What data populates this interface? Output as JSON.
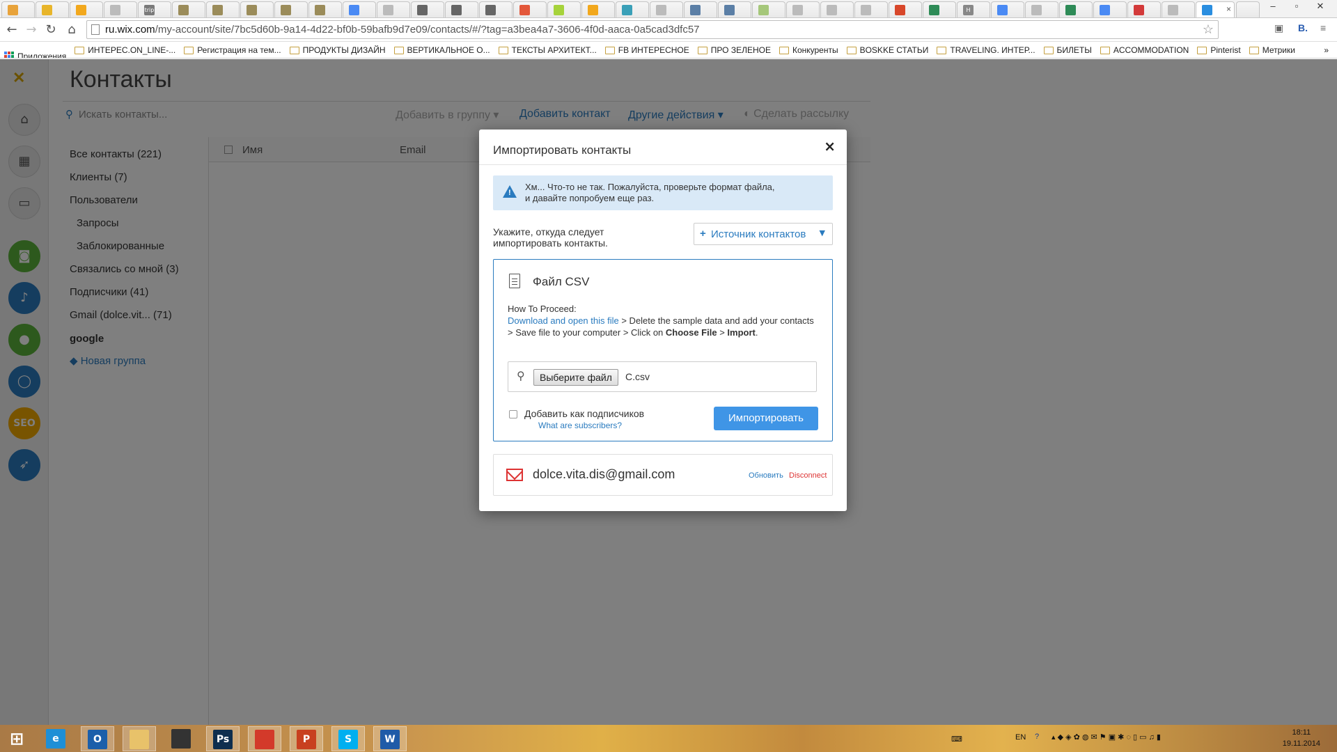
{
  "browser": {
    "tabs": [
      {
        "icon": "blogger-icon",
        "color": "#e8a33b"
      },
      {
        "icon": "wix-icon",
        "color": "#e8b52a"
      },
      {
        "icon": "v-icon",
        "color": "#f2a81d"
      },
      {
        "icon": "page-icon",
        "color": "#bbbbbb"
      },
      {
        "icon": "trip-icon",
        "color": "#7a7a7a",
        "text": "trip"
      },
      {
        "icon": "tv-icon",
        "color": "#9b8c5a"
      },
      {
        "icon": "tv-icon",
        "color": "#9b8c5a"
      },
      {
        "icon": "tv-icon",
        "color": "#9b8c5a"
      },
      {
        "icon": "tv-icon",
        "color": "#9b8c5a"
      },
      {
        "icon": "tv-icon",
        "color": "#9b8c5a"
      },
      {
        "icon": "google-icon",
        "color": "#4a8af4"
      },
      {
        "icon": "page-icon",
        "color": "#bbbbbb"
      },
      {
        "icon": "c-icon",
        "color": "#666666"
      },
      {
        "icon": "c-icon",
        "color": "#666666"
      },
      {
        "icon": "c-icon",
        "color": "#666666"
      },
      {
        "icon": "app-icon",
        "color": "#e3573a"
      },
      {
        "icon": "check-icon",
        "color": "#a6d33b"
      },
      {
        "icon": "v-icon",
        "color": "#f2a81d"
      },
      {
        "icon": "circle-icon",
        "color": "#3aa0b8"
      },
      {
        "icon": "page-icon",
        "color": "#bbbbbb"
      },
      {
        "icon": "vk-icon",
        "color": "#5b7fa6"
      },
      {
        "icon": "vk-icon",
        "color": "#5b7fa6"
      },
      {
        "icon": "image-icon",
        "color": "#a5c77a"
      },
      {
        "icon": "page-icon",
        "color": "#bbbbbb"
      },
      {
        "icon": "page-icon",
        "color": "#bbbbbb"
      },
      {
        "icon": "page-icon",
        "color": "#bbbbbb"
      },
      {
        "icon": "chrome-icon",
        "color": "#d8472a"
      },
      {
        "icon": "sheet-icon",
        "color": "#2e8b57"
      },
      {
        "icon": "h-icon",
        "color": "#888888",
        "text": "H"
      },
      {
        "icon": "google-icon",
        "color": "#4a8af4"
      },
      {
        "icon": "page-icon",
        "color": "#bbbbbb"
      },
      {
        "icon": "sheet-icon",
        "color": "#2e8b57"
      },
      {
        "icon": "google-icon",
        "color": "#4a8af4"
      },
      {
        "icon": "red-icon",
        "color": "#d33a3a"
      },
      {
        "icon": "page-icon",
        "color": "#bbbbbb"
      }
    ],
    "url_host": "ru.wix.com",
    "url_path": "/my-account/site/7bc5d60b-9a14-4d22-bf0b-59bafb9d7e09/contacts/#/?tag=a3bea4a7-3606-4f0d-aaca-0a5cad3dfc57",
    "bookmarks": [
      "Приложения",
      "ИНТЕРЕС.ON_LINE-...",
      "Регистрация на тем...",
      "ПРОДУКТЫ ДИЗАЙН",
      "ВЕРТИКАЛЬНОЕ О...",
      "ТЕКСТЫ АРХИТЕКТ...",
      "FB ИНТЕРЕСНОЕ",
      "ПРО ЗЕЛЕНОЕ",
      "Конкуренты",
      "BOSKKE СТАТЬИ",
      "TRAVELING. ИНТЕР...",
      "БИЛЕТЫ",
      "ACCOMMODATION",
      "Pinterist",
      "Метрики"
    ]
  },
  "page": {
    "title": "Контакты",
    "search_placeholder": "Искать контакты...",
    "actions": {
      "add_to_group": "Добавить в группу",
      "add_contact": "Добавить контакт",
      "other_actions": "Другие действия",
      "send_mailing": "Сделать рассылку"
    },
    "groups": [
      {
        "label": "Все контакты (221)"
      },
      {
        "label": "Клиенты (7)"
      },
      {
        "label": "Пользователи"
      },
      {
        "label": "Запросы"
      },
      {
        "label": "Заблокированные"
      },
      {
        "label": "Связались со мной (3)"
      },
      {
        "label": "Подписчики (41)"
      },
      {
        "label": "Gmail (dolce.vit... (71)"
      },
      {
        "label": "google"
      },
      {
        "label": "Новая группа"
      }
    ],
    "columns": {
      "name": "Имя",
      "email": "Email"
    }
  },
  "modal": {
    "title": "Импортировать контакты",
    "close": "×",
    "alert": "Хм... Что-то не так. Пожалуйста, проверьте формат файла,\nи давайте попробуем еще раз.",
    "source_label": "Укажите, откуда следует\nимпортировать контакты.",
    "source_button": "Источник контактов",
    "csv_title": "Файл CSV",
    "howto_heading": "How To Proceed:",
    "howto_link": "Download and open this file",
    "howto_text_1": " > Delete the sample data and add your contacts > Save file to your computer > Click on ",
    "howto_bold_1": "Choose File",
    "howto_text_2": " > ",
    "howto_bold_2": "Import",
    "howto_text_3": ".",
    "choose_file": "Выберите файл",
    "file_name": "C.csv",
    "subscribe_label": "Добавить как подписчиков",
    "subscribe_help": "What are subscribers?",
    "import_button": "Импортировать",
    "account_email": "dolce.vita.dis@gmail.com",
    "refresh": "Обновить",
    "disconnect": "Disconnect"
  },
  "taskbar": {
    "apps": [
      {
        "name": "start",
        "icon": "windows-icon"
      },
      {
        "name": "internet-explorer",
        "icon": "ie-icon",
        "color": "#1e8fd6",
        "letter": "e"
      },
      {
        "name": "outlook",
        "icon": "outlook-icon",
        "color": "#1b5faa",
        "letter": "O"
      },
      {
        "name": "explorer",
        "icon": "folder-icon",
        "color": "#e8c26a",
        "letter": ""
      },
      {
        "name": "media",
        "icon": "camera-icon",
        "color": "#333333",
        "letter": ""
      },
      {
        "name": "photoshop",
        "icon": "photoshop-icon",
        "color": "#0e2e4e",
        "letter": "Ps"
      },
      {
        "name": "chrome",
        "icon": "chrome-icon",
        "color": "#d33a2a",
        "letter": ""
      },
      {
        "name": "powerpoint",
        "icon": "powerpoint-icon",
        "color": "#c8401f",
        "letter": "P"
      },
      {
        "name": "skype",
        "icon": "skype-icon",
        "color": "#00aff0",
        "letter": "S"
      },
      {
        "name": "word",
        "icon": "word-icon",
        "color": "#1f5ba8",
        "letter": "W"
      }
    ],
    "lang": "EN",
    "time": "18:11",
    "date": "19.11.2014"
  }
}
